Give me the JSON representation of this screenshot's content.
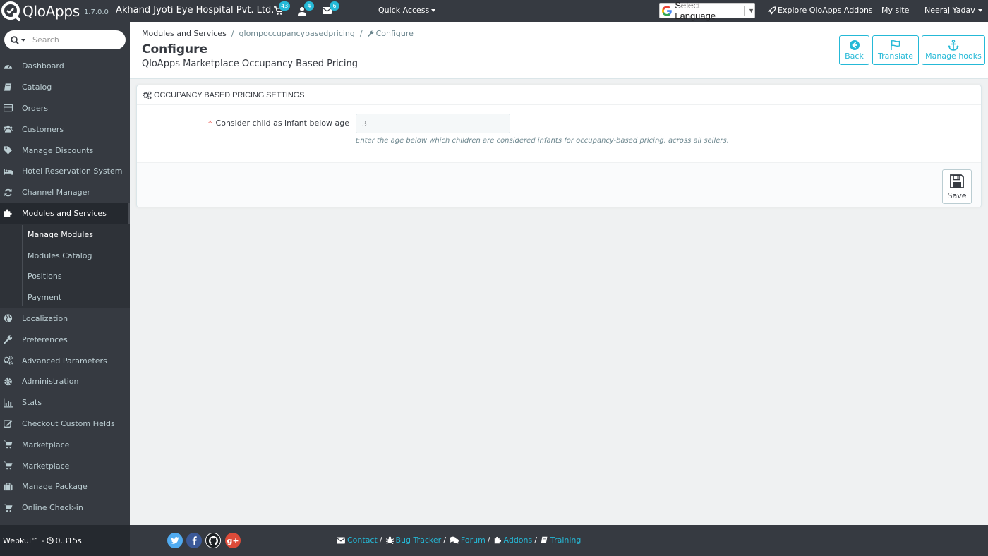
{
  "header": {
    "logo_text": "QloApps",
    "version": "1.7.0.0",
    "shop_name": "Akhand Jyoti Eye Hospital Pvt. Ltd.",
    "notifications": {
      "orders": "43",
      "customers": "4",
      "messages": "6"
    },
    "quick_access_label": "Quick Access",
    "language_select_label": "Select Language",
    "explore_label": "Explore QloApps Addons",
    "mysite_label": "My site",
    "user_name": "Neeraj Yadav"
  },
  "sidebar": {
    "search_placeholder": "Search",
    "items": [
      {
        "label": "Dashboard",
        "icon": "dashboard-icon"
      },
      {
        "label": "Catalog",
        "icon": "book-icon"
      },
      {
        "label": "Orders",
        "icon": "credit-card-icon"
      },
      {
        "label": "Customers",
        "icon": "users-icon"
      },
      {
        "label": "Manage Discounts",
        "icon": "tags-icon"
      },
      {
        "label": "Hotel Reservation System",
        "icon": "bed-icon"
      },
      {
        "label": "Channel Manager",
        "icon": "refresh-icon"
      },
      {
        "label": "Modules and Services",
        "icon": "puzzle-icon",
        "active": true
      },
      {
        "label": "Localization",
        "icon": "globe-icon"
      },
      {
        "label": "Preferences",
        "icon": "wrench-icon"
      },
      {
        "label": "Advanced Parameters",
        "icon": "cogs-icon"
      },
      {
        "label": "Administration",
        "icon": "gear-icon"
      },
      {
        "label": "Stats",
        "icon": "bar-chart-icon"
      },
      {
        "label": "Checkout Custom Fields",
        "icon": "edit-icon"
      },
      {
        "label": "Marketplace",
        "icon": "cart-icon"
      },
      {
        "label": "Marketplace",
        "icon": "cart-icon"
      },
      {
        "label": "Manage Package",
        "icon": "briefcase-icon"
      },
      {
        "label": "Online Check-in",
        "icon": "cart-icon"
      }
    ],
    "sub_items": [
      {
        "label": "Manage Modules",
        "active": true
      },
      {
        "label": "Modules Catalog"
      },
      {
        "label": "Positions"
      },
      {
        "label": "Payment"
      }
    ]
  },
  "breadcrumb": {
    "items": [
      "Modules and Services",
      "qlompoccupancybasedpricing",
      "Configure"
    ],
    "separator": "/"
  },
  "page": {
    "title": "Configure",
    "subtitle": "QloApps Marketplace Occupancy Based Pricing"
  },
  "toolbar": {
    "back_label": "Back",
    "translate_label": "Translate",
    "manage_hooks_label": "Manage hooks"
  },
  "panel": {
    "heading": "OCCUPANCY BASED PRICING SETTINGS",
    "required_mark": "*",
    "field_label": "Consider child as infant below age",
    "field_value": "3",
    "help_text": "Enter the age below which children are considered infants for occupancy-based pricing, across all sellers.",
    "save_label": "Save"
  },
  "footer": {
    "brand": "Webkul™ -",
    "load_time": "0.315s",
    "social_letters": {
      "google_plus": "g+"
    },
    "links": [
      "Contact",
      "Bug Tracker",
      "Forum",
      "Addons",
      "Training"
    ],
    "separator": "/"
  },
  "colors": {
    "accent": "#25b9d7",
    "sidebar_bg": "#363a41",
    "required": "#e9473f"
  }
}
